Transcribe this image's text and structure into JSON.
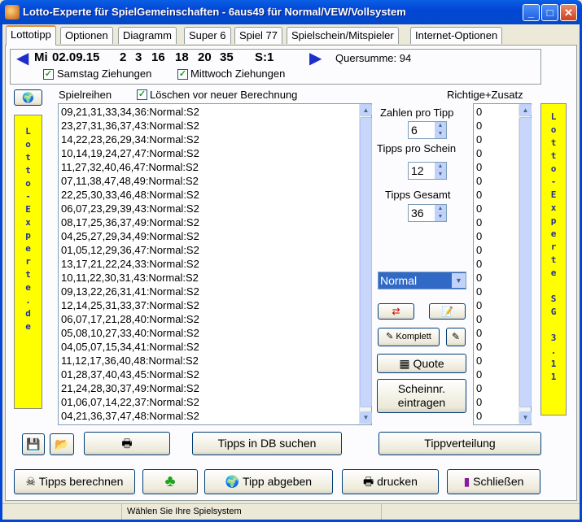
{
  "window": {
    "title": "Lotto-Experte für SpielGemeinschaften - 6aus49 für Normal/VEW/Vollsystem",
    "minimize": "_",
    "maximize": "□",
    "close": "✕"
  },
  "tabs": [
    "Lottotipp",
    "Optionen",
    "Diagramm",
    "Super 6",
    "Spiel 77",
    "Spielschein/Mitspieler",
    "Internet-Optionen"
  ],
  "draw": {
    "day": "Mi",
    "date": "02.09.15",
    "numbers": [
      "2",
      "3",
      "16",
      "18",
      "20",
      "35"
    ],
    "superzahl": "S:1",
    "quersumme_label": "Quersumme: 94",
    "samstag_label": "Samstag Ziehungen",
    "mittwoch_label": "Mittwoch Ziehungen"
  },
  "labels": {
    "spielreihen": "Spielreihen",
    "loeschen": "Löschen vor neuer Berechnung",
    "richtige": "Richtige+Zusatz"
  },
  "spielreihen": [
    "09,21,31,33,34,36:Normal:S2",
    "23,27,31,36,37,43:Normal:S2",
    "14,22,23,26,29,34:Normal:S2",
    "10,14,19,24,27,47:Normal:S2",
    "11,27,32,40,46,47:Normal:S2",
    "07,11,38,47,48,49:Normal:S2",
    "22,25,30,33,46,48:Normal:S2",
    "06,07,23,29,39,43:Normal:S2",
    "08,17,25,36,37,49:Normal:S2",
    "04,25,27,29,34,49:Normal:S2",
    "01,05,12,29,36,47:Normal:S2",
    "13,17,21,22,24,33:Normal:S2",
    "10,11,22,30,31,43:Normal:S2",
    "09,13,22,26,31,41:Normal:S2",
    "12,14,25,31,33,37:Normal:S2",
    "06,07,17,21,28,40:Normal:S2",
    "05,08,10,27,33,40:Normal:S2",
    "04,05,07,15,34,41:Normal:S2",
    "11,12,17,36,40,48:Normal:S2",
    "01,28,37,40,43,45:Normal:S2",
    "21,24,28,30,37,49:Normal:S2",
    "01,06,07,14,22,37:Normal:S2",
    "04,21,36,37,47,48:Normal:S2"
  ],
  "richtige": [
    "0",
    "0",
    "0",
    "0",
    "0",
    "0",
    "0",
    "0",
    "0",
    "0",
    "0",
    "0",
    "0",
    "0",
    "0",
    "0",
    "0",
    "0",
    "0",
    "0",
    "0",
    "0",
    "0"
  ],
  "controls": {
    "zahlen_pro_tipp_label": "Zahlen pro Tipp",
    "zahlen_pro_tipp": "6",
    "tipps_pro_schein_label": "Tipps pro Schein",
    "tipps_pro_schein": "12",
    "tipps_gesamt_label": "Tipps Gesamt",
    "tipps_gesamt": "36",
    "system_select": "Normal",
    "komplett": "Komplett",
    "quote": "Quote",
    "scheinnr": "Scheinnr. eintragen"
  },
  "banners": {
    "left": "Lotto-Experte.de",
    "right": "Lotto-Experte SG 3.11"
  },
  "buttons": {
    "tipps_in_db": "Tipps in DB suchen",
    "tippverteilung": "Tippverteilung",
    "tipps_berechnen": "Tipps berechnen",
    "tipp_abgeben": "Tipp abgeben",
    "drucken": "drucken",
    "schliessen": "Schließen"
  },
  "status": "Wählen Sie Ihre Spielsystem",
  "colors": {
    "banner_bg": "#ffff00",
    "banner_text": "#1e2e9a",
    "select_bg": "#3169c6"
  }
}
